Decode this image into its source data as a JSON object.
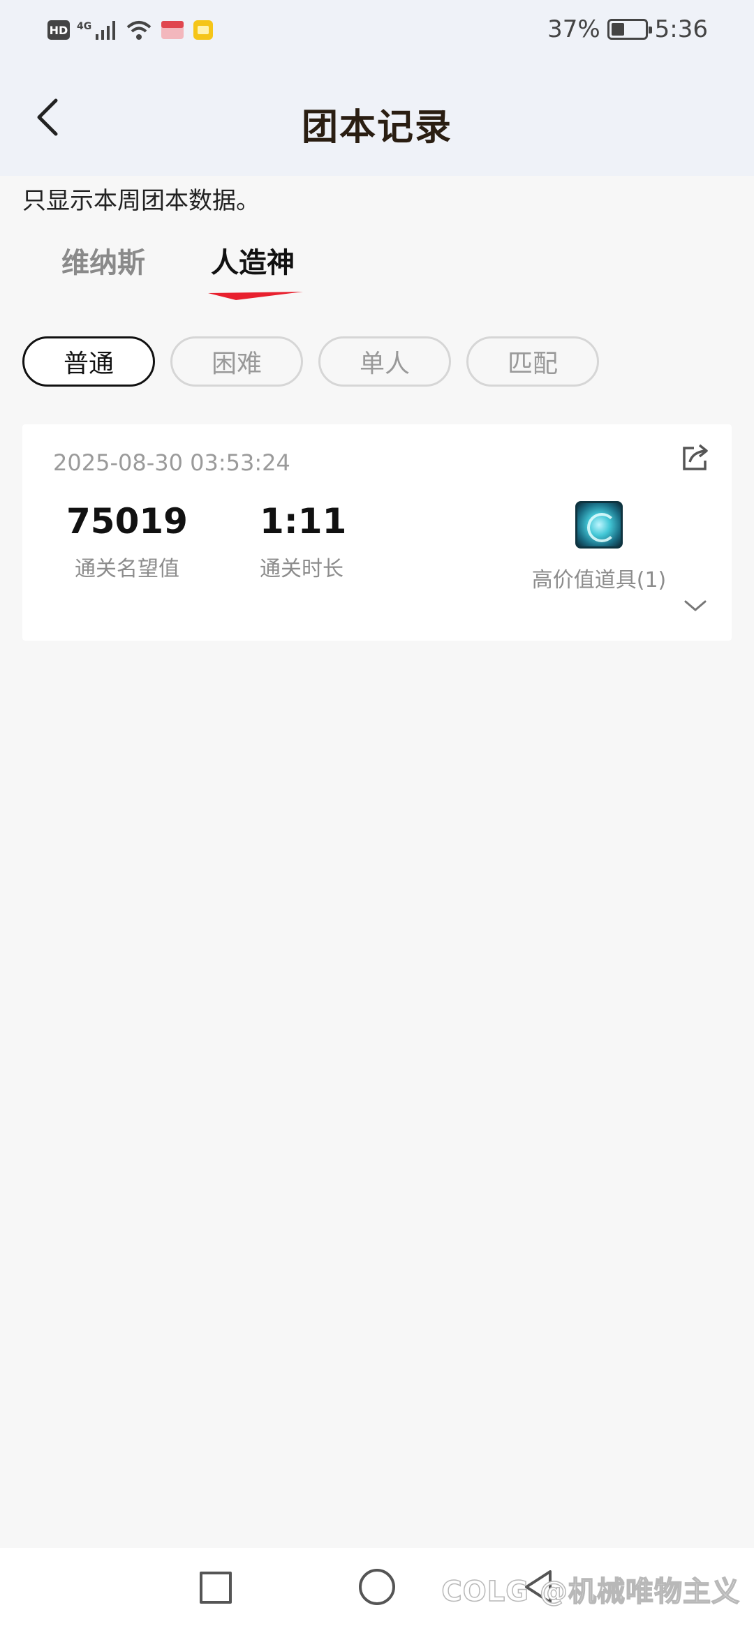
{
  "status_bar": {
    "hd": "HD",
    "network": "4G",
    "battery_percent_text": "37%",
    "battery_level": 0.37,
    "time": "5:36",
    "icons": [
      "signal-icon",
      "wifi-icon",
      "notification-icon",
      "gallery-icon",
      "battery-icon"
    ]
  },
  "header": {
    "title": "团本记录",
    "back_icon": "chevron-left-icon"
  },
  "note": "只显示本周团本数据。",
  "tabs": [
    {
      "label": "维纳斯",
      "active": false
    },
    {
      "label": "人造神",
      "active": true
    }
  ],
  "filters": [
    {
      "label": "普通",
      "selected": true
    },
    {
      "label": "困难",
      "selected": false
    },
    {
      "label": "单人",
      "selected": false
    },
    {
      "label": "匹配",
      "selected": false
    }
  ],
  "record": {
    "date": "2025-08-30 03:53:24",
    "reputation_value": "75019",
    "reputation_label": "通关名望值",
    "duration_value": "1:11",
    "duration_label": "通关时长",
    "item_label": "高价值道具(1)",
    "share_icon": "share-icon",
    "expand_icon": "chevron-down-icon"
  },
  "nav": {
    "icons": [
      "recent-apps-icon",
      "home-icon",
      "back-icon"
    ]
  },
  "watermark": "COLG @机械唯物主义",
  "colors": {
    "header_bg": "#eff2f8",
    "page_bg": "#f7f7f7",
    "accent_red": "#e8202e",
    "title_color": "#2a1e12"
  }
}
